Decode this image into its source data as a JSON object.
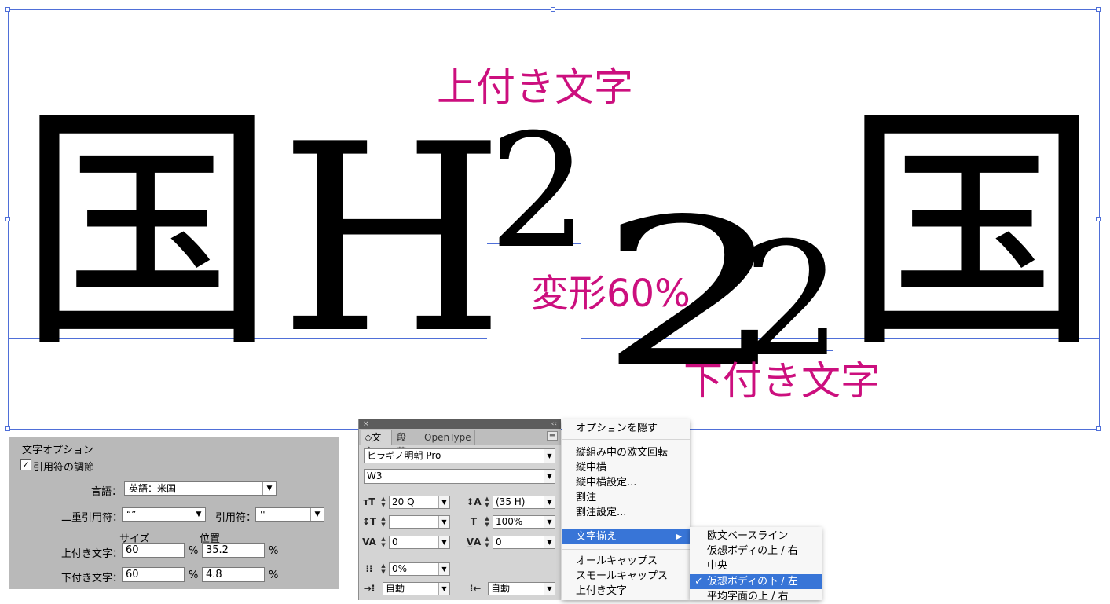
{
  "artboard": {
    "glyph_kanji_left": "国",
    "glyph_h": "H",
    "glyph_superscript": "2",
    "glyph_wide_two": "2",
    "glyph_subscript": "2",
    "glyph_kanji_right": "国",
    "label_superscript": "上付き文字",
    "label_scaled": "変形60%",
    "label_subscript": "下付き文字"
  },
  "char_options": {
    "group_title": "文字オプション",
    "quotes_checkbox_label": "引用符の調節",
    "quotes_checked": true,
    "language_label": "言語：",
    "language_value": "英語：米国",
    "double_quote_label": "二重引用符：",
    "double_quote_value": "“”",
    "single_quote_label": "引用符：",
    "single_quote_value": "''",
    "col_size": "サイズ",
    "col_position": "位置",
    "superscript_label": "上付き文字：",
    "superscript_size": "60",
    "superscript_position": "35.2",
    "subscript_label": "下付き文字：",
    "subscript_size": "60",
    "subscript_position": "4.8",
    "percent": "%"
  },
  "char_panel": {
    "close_glyph": "×",
    "collapse_glyph": "‹‹",
    "tabs": [
      "◇文字",
      "段落",
      "OpenType"
    ],
    "active_tab": 0,
    "font_family": "ヒラギノ明朝 Pro",
    "font_style": "W3",
    "font_size": "20 Q",
    "leading": "(35 H)",
    "vertical_scale": "",
    "horizontal_scale": "100%",
    "kerning": "0",
    "tracking": "0",
    "tsume": "0%",
    "aki_left": "自動",
    "aki_right": "自動"
  },
  "panel_menu": {
    "items": [
      "オプションを隠す",
      "縦組み中の欧文回転",
      "縦中横",
      "縦中横設定...",
      "割注",
      "割注設定...",
      "文字揃え",
      "オールキャップス",
      "スモールキャップス",
      "上付き文字"
    ],
    "highlighted_index": 6,
    "submenu_arrow": "▶"
  },
  "align_submenu": {
    "items": [
      "欧文ベースライン",
      "仮想ボディの上 / 右",
      "中央",
      "仮想ボディの下 / 左",
      "平均字面の上 / 右"
    ],
    "checked_index": 3,
    "check_mark": "✓"
  },
  "colors": {
    "accent_magenta": "#cc0f7e",
    "selection_blue": "#4f6fd8",
    "menu_highlight": "#3875d7"
  }
}
